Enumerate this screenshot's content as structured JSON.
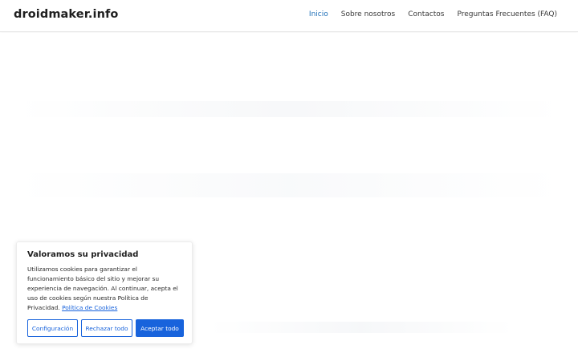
{
  "header": {
    "site_title": "droidmaker.info",
    "nav": [
      {
        "label": "Inicio",
        "active": true
      },
      {
        "label": "Sobre nosotros",
        "active": false
      },
      {
        "label": "Contactos",
        "active": false
      },
      {
        "label": "Preguntas Frecuentes (FAQ)",
        "active": false
      }
    ]
  },
  "cookie_banner": {
    "title": "Valoramos su privacidad",
    "text": "Utilizamos cookies para garantizar el funcionamiento básico del sitio y mejorar su experiencia de navegación. Al continuar, acepta el uso de cookies según nuestra Política de Privacidad.",
    "link_label": "Política de Cookies",
    "buttons": {
      "config": "Configuración",
      "reject": "Rechazar todo",
      "accept": "Aceptar todo"
    }
  },
  "colors": {
    "accent": "#1863dc",
    "nav_active": "#1e6fb8",
    "text": "#222222",
    "background": "#ffffff"
  }
}
